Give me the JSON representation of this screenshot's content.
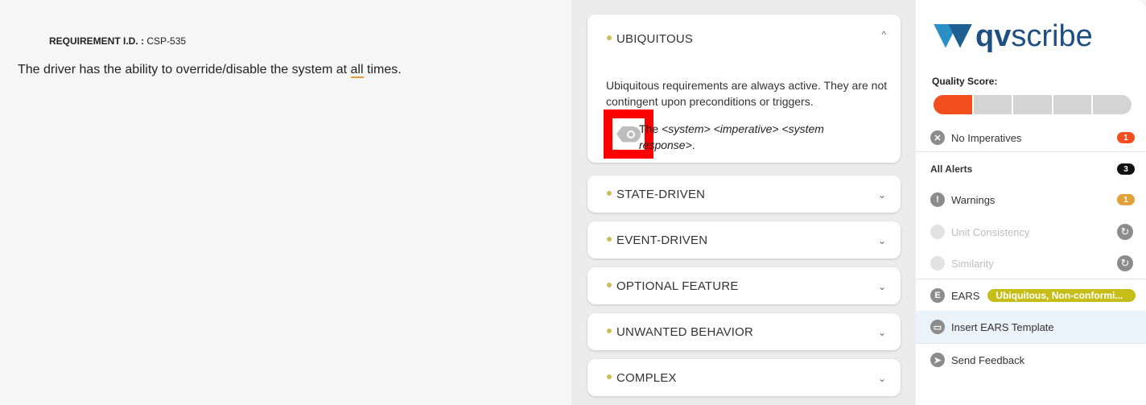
{
  "editor": {
    "req_id_label": "REQUIREMENT I.D. :",
    "req_id_value": "CSP-535",
    "text_before": "The driver has the ability to override/disable the system at ",
    "text_highlight": "all",
    "text_after": " times."
  },
  "ears_panel": {
    "ubiquitous": {
      "label": "UBIQUITOUS",
      "chevron": "^",
      "description": "Ubiquitous requirements are always active. They are not contingent upon preconditions or triggers.",
      "template_prefix": "The ",
      "template_body": "<system> <imperative> <system response>",
      "template_suffix": "."
    },
    "collapsed": [
      {
        "label": "STATE-DRIVEN"
      },
      {
        "label": "EVENT-DRIVEN"
      },
      {
        "label": "OPTIONAL FEATURE"
      },
      {
        "label": "UNWANTED BEHAVIOR"
      },
      {
        "label": "COMPLEX"
      }
    ],
    "chevron_down": "⌄"
  },
  "sidebar": {
    "logo_bold": "qv",
    "logo_rest": "scribe",
    "quality_score_label": "Quality Score:",
    "quality_score_level": 1,
    "quality_score_max": 5,
    "no_imperatives": {
      "label": "No Imperatives",
      "count": "1",
      "color": "#f24e1e"
    },
    "all_alerts": {
      "label": "All Alerts",
      "count": "3",
      "color": "#111111"
    },
    "warnings": {
      "label": "Warnings",
      "count": "1",
      "color": "#e0a03a"
    },
    "unit_consistency": {
      "label": "Unit Consistency"
    },
    "similarity": {
      "label": "Similarity"
    },
    "ears": {
      "label": "EARS",
      "pill": "Ubiquitous, Non-conformi..."
    },
    "insert_template": {
      "label": "Insert EARS Template"
    },
    "send_feedback": {
      "label": "Send Feedback"
    }
  }
}
